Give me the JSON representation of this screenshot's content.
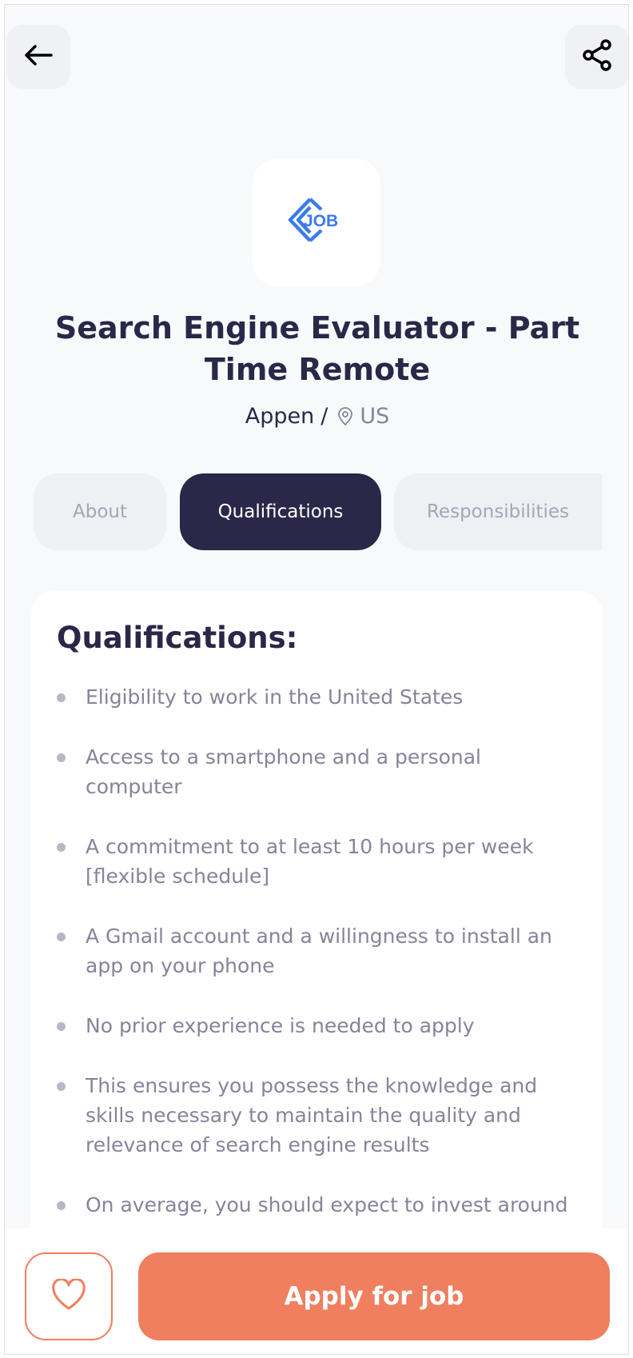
{
  "header": {
    "back_icon": "arrow-left-icon",
    "share_icon": "share-icon"
  },
  "job": {
    "logo_icon": "job-logo-icon",
    "logo_text": "JOB",
    "title": "Search Engine Evaluator - Part Time Remote",
    "company": "Appen",
    "separator": "/",
    "location_icon": "map-pin-icon",
    "location": "US"
  },
  "tabs": [
    {
      "label": "About",
      "active": false
    },
    {
      "label": "Qualifications",
      "active": true
    },
    {
      "label": "Responsibilities",
      "active": false
    }
  ],
  "section": {
    "title": "Qualifications:",
    "items": [
      "Eligibility to work in the United States",
      "Access to a smartphone and a personal computer",
      "A commitment to at least 10 hours per week [flexible schedule]",
      "A Gmail account and a willingness to install an app on your phone",
      "No prior experience is needed to apply",
      "This ensures you possess the knowledge and skills necessary to maintain the quality and relevance of search engine results",
      "On average, you should expect to invest around"
    ]
  },
  "footer": {
    "favorite_icon": "heart-icon",
    "apply_label": "Apply for job"
  },
  "colors": {
    "primary": "#2b2748",
    "accent": "#ef7f5e",
    "logo_blue": "#3b7bea",
    "muted_text": "#85849a"
  }
}
